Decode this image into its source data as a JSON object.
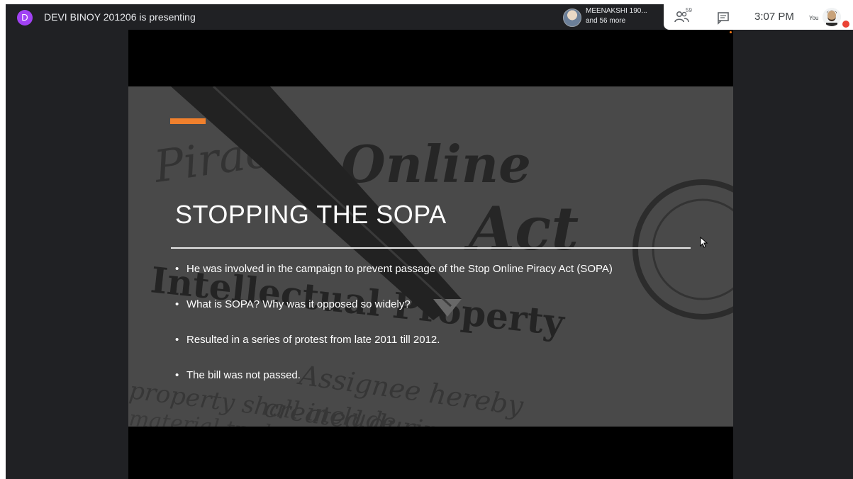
{
  "topbar": {
    "presenter_initial": "D",
    "presenting_text": "DEVI BINOY 201206 is presenting",
    "participant_chip": {
      "name": "MEENAKSHI 190...",
      "more": "and 56 more"
    },
    "people_count": "59",
    "time": "3:07 PM",
    "you_label": "You"
  },
  "slide": {
    "title": "STOPPING THE SOPA",
    "bullets": [
      "He was involved in the campaign to prevent passage of the Stop Online Piracy Act (SOPA)",
      "What is SOPA? Why was it opposed so widely?",
      "Resulted in a series of protest from late 2011 till 2012.",
      "The bill was not passed."
    ],
    "background_words": [
      "Online",
      "Piracy",
      "Act",
      "Intellectual Property",
      "Assignee hereby",
      "created during",
      "property shall include",
      "material trade"
    ]
  },
  "colors": {
    "accent": "#f0802d",
    "presenter_avatar": "#a142f4",
    "background": "#202124"
  },
  "icons": [
    "people-icon",
    "chat-icon",
    "cursor-icon"
  ]
}
